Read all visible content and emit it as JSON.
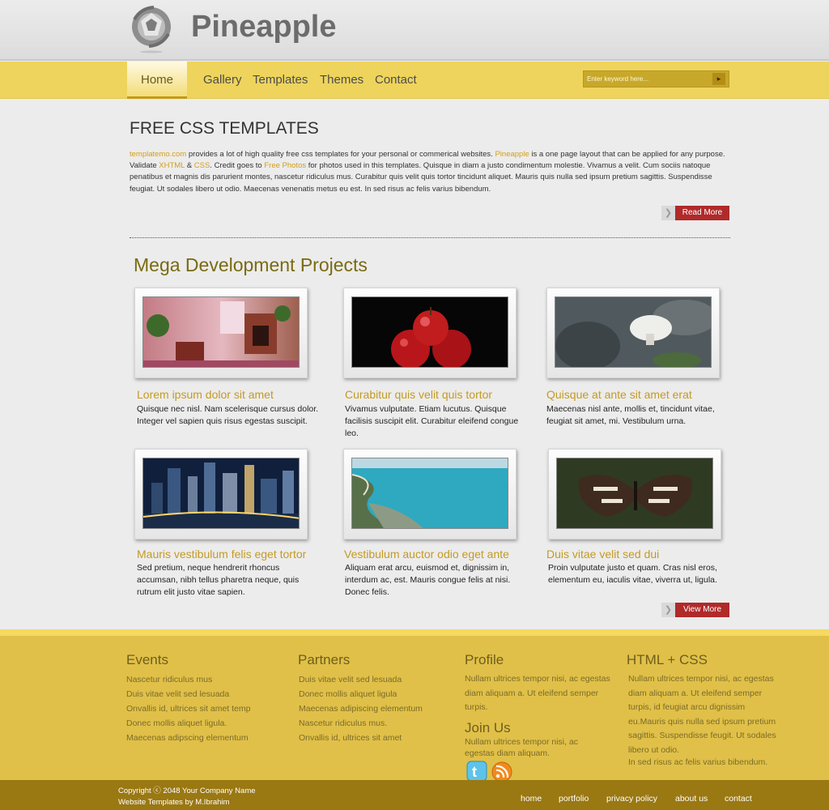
{
  "brand": {
    "name": "Pineapple"
  },
  "nav": {
    "items": [
      "Home",
      "Gallery",
      "Templates",
      "Themes",
      "Contact"
    ],
    "search_placeholder": "Enter keyword here...",
    "search_button_glyph": "▸"
  },
  "intro": {
    "title": "FREE CSS TEMPLATES",
    "link_templatemo": "templatemo.com",
    "text_1": " provides a lot of high quality free css templates for your personal or commerical websites. ",
    "link_pineapple": "Pineapple",
    "text_2": " is a one page layout that can be applied for any purpose. Validate ",
    "link_xhtml": "XHTML",
    "text_3": " & ",
    "link_css": "CSS",
    "text_4": ". Credit goes to ",
    "link_free_photos": "Free Photos",
    "text_5": " for photos used in this templates. Quisque in diam a justo condimentum molestie. Vivamus a velit. Cum sociis natoque penatibus et magnis dis parurient montes, nascetur ridiculus mus. Curabitur quis velit quis tortor tincidunt aliquet. Mauris quis nulla sed ipsum pretium sagittis. Suspendisse feugiat. Ut sodales libero ut odio. Maecenas venenatis metus eu est. In sed risus ac felis varius bibendum.",
    "read_more": "Read More"
  },
  "projects": {
    "title": "Mega Development Projects",
    "items": [
      {
        "title": "Lorem ipsum dolor sit amet",
        "desc": "Quisque nec nisl. Nam scelerisque cursus dolor. Integer vel sapien quis risus egestas suscipit.",
        "image": "living-room-photo"
      },
      {
        "title": "Curabitur quis velit quis tortor",
        "desc": "Vivamus vulputate. Etiam lucutus. Quisque facilisis suscipit elit. Curabitur eleifend congue leo.",
        "image": "red-apples-photo"
      },
      {
        "title": "Quisque at ante sit amet erat",
        "desc": "Maecenas nisl ante, mollis et, tincidunt vitae, feugiat sit amet, mi. Vestibulum urna.",
        "image": "mushroom-photo"
      },
      {
        "title": "Mauris vestibulum felis eget tortor",
        "desc": "Sed pretium, neque hendrerit rhoncus accumsan, nibh tellus pharetra neque, quis rutrum elit justo vitae sapien.",
        "image": "city-night-photo"
      },
      {
        "title": "Vestibulum auctor odio eget ante",
        "desc": "Aliquam erat arcu, euismod et, dignissim in, interdum ac, est. Mauris congue felis at nisi. Donec felis.",
        "image": "coastline-photo"
      },
      {
        "title": "Duis vitae velit sed dui",
        "desc": "Proin vulputate justo et quam. Cras nisl eros, elementum eu, iaculis vitae, viverra ut, ligula.",
        "image": "butterfly-photo"
      }
    ],
    "view_more": "View More"
  },
  "footer": {
    "events": {
      "title": "Events",
      "links": [
        "Nascetur ridiculus mus",
        "Duis vitae velit sed lesuada",
        "Onvallis id, ultrices sit amet temp",
        "Donec mollis aliquet ligula.",
        "Maecenas adipscing elementum"
      ]
    },
    "partners": {
      "title": "Partners",
      "links": [
        "Duis vitae velit sed lesuada",
        "Donec mollis aliquet ligula",
        "Maecenas adipiscing elementum",
        "Nascetur ridiculus mus.",
        "Onvallis id, ultrices sit amet"
      ]
    },
    "profile": {
      "title": "Profile",
      "text": "Nullam ultrices tempor nisi, ac egestas diam aliquam a. Ut eleifend semper turpis."
    },
    "join": {
      "title": "Join Us",
      "text": "Nullam ultrices tempor nisi, ac egestas diam aliquam."
    },
    "htmlcss": {
      "title": "HTML + CSS",
      "text_1": "Nullam ultrices tempor nisi, ac egestas diam aliquam a. Ut eleifend semper turpis, id feugiat arcu dignissim eu.Mauris quis nulla sed ipsum pretium sagittis. Suspendisse feugit. Ut sodales libero ut odio.",
      "text_2": "In sed risus ac felis varius bibendum."
    }
  },
  "bottom": {
    "copyright_line1": "Copyright  ⓒ 2048 Your Company Name",
    "copyright_line2": "Website Templates by M.Ibrahim",
    "links": [
      "home",
      "portfolio",
      "privacy policy",
      "about us",
      "contact"
    ]
  },
  "colors": {
    "nav_bg": "#eed45c",
    "accent_title": "#7a6a12",
    "link_gold": "#c49a24",
    "button_red": "#b02a2a",
    "footer_bg": "#e0c048",
    "bottom_bar": "#9a7812"
  }
}
